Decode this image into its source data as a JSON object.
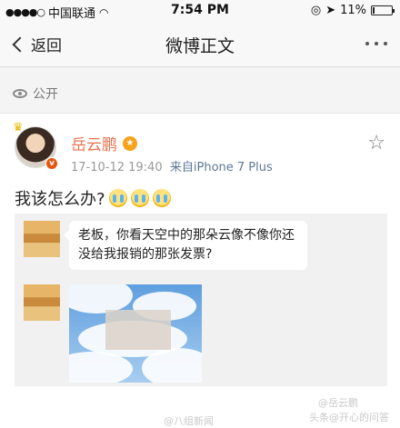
{
  "status_bar": {
    "carrier": "中国联通",
    "time": "7:54 PM",
    "battery": "11%",
    "battery_level": 0.11
  },
  "nav": {
    "back_label": "返回",
    "title": "微博正文"
  },
  "visibility_label": "公开",
  "post": {
    "author": "岳云鹏",
    "timestamp": "17-10-12 19:40",
    "source": "来自iPhone 7 Plus",
    "text": "我该怎么办?",
    "emoji": [
      "crying-face",
      "crying-face",
      "crying-face"
    ]
  },
  "quote": {
    "message": "老板，你看天空中的那朵云像不像你还没给我报销的那张发票?"
  },
  "watermarks": [
    "@八组新闻",
    "@岳云鹏",
    "头条@开心的问答"
  ]
}
